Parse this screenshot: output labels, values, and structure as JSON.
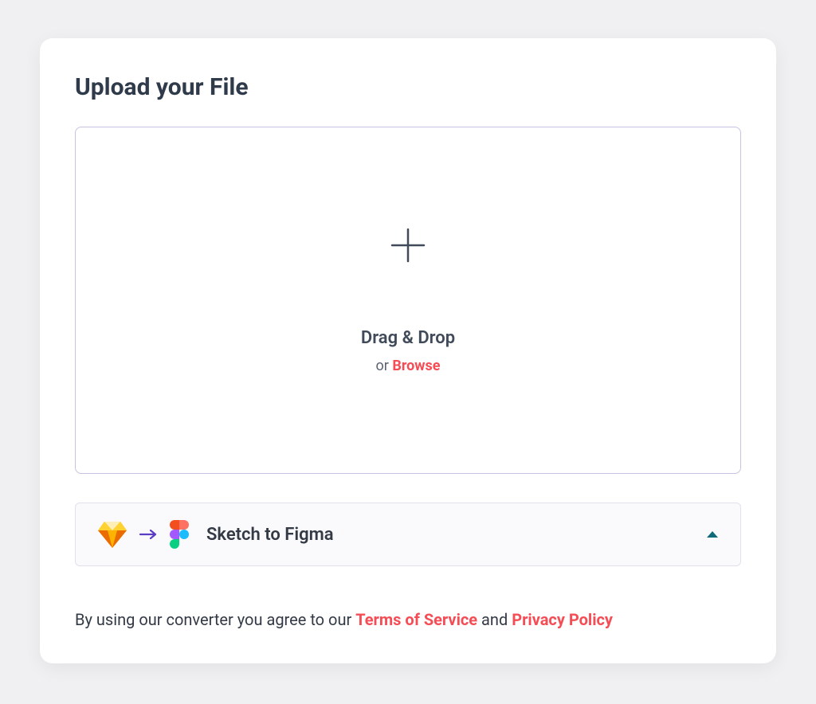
{
  "header": {
    "title": "Upload your File"
  },
  "dropzone": {
    "drag_drop_label": "Drag & Drop",
    "or_label": "or ",
    "browse_label": "Browse"
  },
  "converter": {
    "selected_label": "Sketch to Figma",
    "from_icon": "sketch-icon",
    "to_icon": "figma-icon"
  },
  "agreement": {
    "prefix": "By using our converter you agree to our ",
    "tos_label": "Terms of Service",
    "middle": " and ",
    "privacy_label": "Privacy Policy"
  },
  "colors": {
    "accent_red": "#f44d55",
    "text_dark": "#2f3a4a",
    "border_light": "#c9c2e0"
  }
}
